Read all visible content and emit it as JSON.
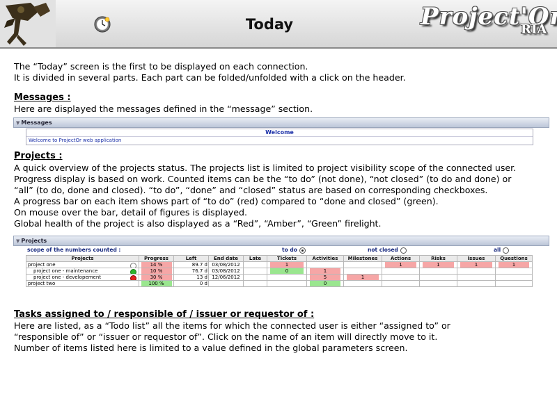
{
  "header": {
    "title": "Today",
    "brand": "Project'Or",
    "brand_sub": "RIA"
  },
  "intro": [
    "The “Today” screen is the first to be displayed on each connection.",
    "It is divided in several parts. Each part can be folded/unfolded with a click on the header."
  ],
  "messages": {
    "heading": "Messages :",
    "desc": "Here are displayed the messages defined in the “message” section.",
    "panel_title": "Messages",
    "box_title": "Welcome",
    "box_text": "Welcome to ProjectOr web application"
  },
  "projects": {
    "heading": "Projects :",
    "desc": [
      "A quick overview of the projects status. The projects list is limited to project visibility scope of the connected user.",
      "Progress display is based on work. Counted items can be the “to do” (not done), “not closed” (to do and done) or",
      "“all” (to do, done and closed). “to do”, “done” and “closed” status are based on corresponding checkboxes.",
      "A progress bar on each item shows part of “to do” (red) compared to “done and closed” (green).",
      "On mouse over the bar, detail of figures is displayed.",
      "Global health of the project is also displayed as a “Red”, “Amber”, “Green” firelight."
    ],
    "panel_title": "Projects",
    "scope_label": "scope of the numbers counted :",
    "scope_options": [
      "to do",
      "not closed",
      "all"
    ],
    "columns": [
      "Projects",
      "Progress",
      "Left",
      "End date",
      "Late",
      "Tickets",
      "Activities",
      "Milestones",
      "Actions",
      "Risks",
      "Issues",
      "Questions"
    ],
    "rows": [
      {
        "name": "project one",
        "health": "white",
        "progress": "14 %",
        "progress_color": "red",
        "left": "89.7 d",
        "end": "03/08/2012",
        "late": "",
        "tickets": "1",
        "tickets_c": "red",
        "activities": "",
        "activities_c": "",
        "milestones": "",
        "milestones_c": "",
        "actions": "1",
        "actions_c": "red",
        "risks": "1",
        "risks_c": "red",
        "issues": "1",
        "issues_c": "red",
        "questions": "1",
        "questions_c": "red"
      },
      {
        "name": "project one - maintenance",
        "health": "green",
        "progress": "10 %",
        "progress_color": "red",
        "left": "76.7 d",
        "end": "03/08/2012",
        "late": "",
        "tickets": "0",
        "tickets_c": "green",
        "activities": "1",
        "activities_c": "red",
        "milestones": "",
        "milestones_c": "",
        "actions": "",
        "actions_c": "",
        "risks": "",
        "risks_c": "",
        "issues": "",
        "issues_c": "",
        "questions": "",
        "questions_c": ""
      },
      {
        "name": "project one - developement",
        "health": "red",
        "progress": "30 %",
        "progress_color": "red",
        "left": "13 d",
        "end": "12/06/2012",
        "late": "",
        "tickets": "",
        "tickets_c": "",
        "activities": "5",
        "activities_c": "red",
        "milestones": "1",
        "milestones_c": "red",
        "actions": "",
        "actions_c": "",
        "risks": "",
        "risks_c": "",
        "issues": "",
        "issues_c": "",
        "questions": "",
        "questions_c": ""
      },
      {
        "name": "project two",
        "health": "",
        "progress": "100 %",
        "progress_color": "green",
        "left": "0 d",
        "end": "",
        "late": "",
        "tickets": "",
        "tickets_c": "",
        "activities": "0",
        "activities_c": "green",
        "milestones": "",
        "milestones_c": "",
        "actions": "",
        "actions_c": "",
        "risks": "",
        "risks_c": "",
        "issues": "",
        "issues_c": "",
        "questions": "",
        "questions_c": ""
      }
    ]
  },
  "tasks": {
    "heading": "Tasks assigned to / responsible of / issuer or requestor of :",
    "desc": [
      "Here are listed, as a “Todo list” all the items for which the connected user is either “assigned to” or",
      "“responsible of” or “issuer or requestor of”. Click on the name of an item will directly move to it.",
      "Number of items listed here is limited to a value defined in the global parameters screen."
    ]
  }
}
